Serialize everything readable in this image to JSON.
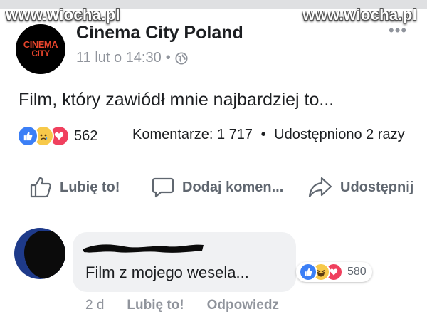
{
  "watermark": {
    "left": "www.wiocha.pl",
    "right": "www.wiocha.pl"
  },
  "post": {
    "page_name": "Cinema City Poland",
    "avatar_line1": "CINEMA",
    "avatar_line2": "CITY",
    "timestamp": "11 lut o 14:30",
    "separator": "•",
    "privacy_icon": "globe-icon",
    "text": "Film, który zawiódł mnie najbardziej to...",
    "reactions": {
      "icons": [
        "like",
        "sad",
        "love"
      ],
      "count": "562"
    },
    "comments_count": "Komentarze: 1 717",
    "shares_count": "Udostępniono 2 razy",
    "stats_separator": "•"
  },
  "actions": {
    "like": "Lubię to!",
    "comment": "Dodaj komen...",
    "share": "Udostępnij"
  },
  "comment": {
    "text": "Film z mojego wesela...",
    "reactions": {
      "icons": [
        "like",
        "haha",
        "love"
      ],
      "count": "580"
    },
    "age": "2 d",
    "like": "Lubię to!",
    "reply": "Odpowiedz"
  },
  "colors": {
    "like_blue": "#3b7ff6",
    "love_red": "#f0405e",
    "emoji_yellow": "#f7c94a",
    "muted_gray": "#90949c"
  }
}
